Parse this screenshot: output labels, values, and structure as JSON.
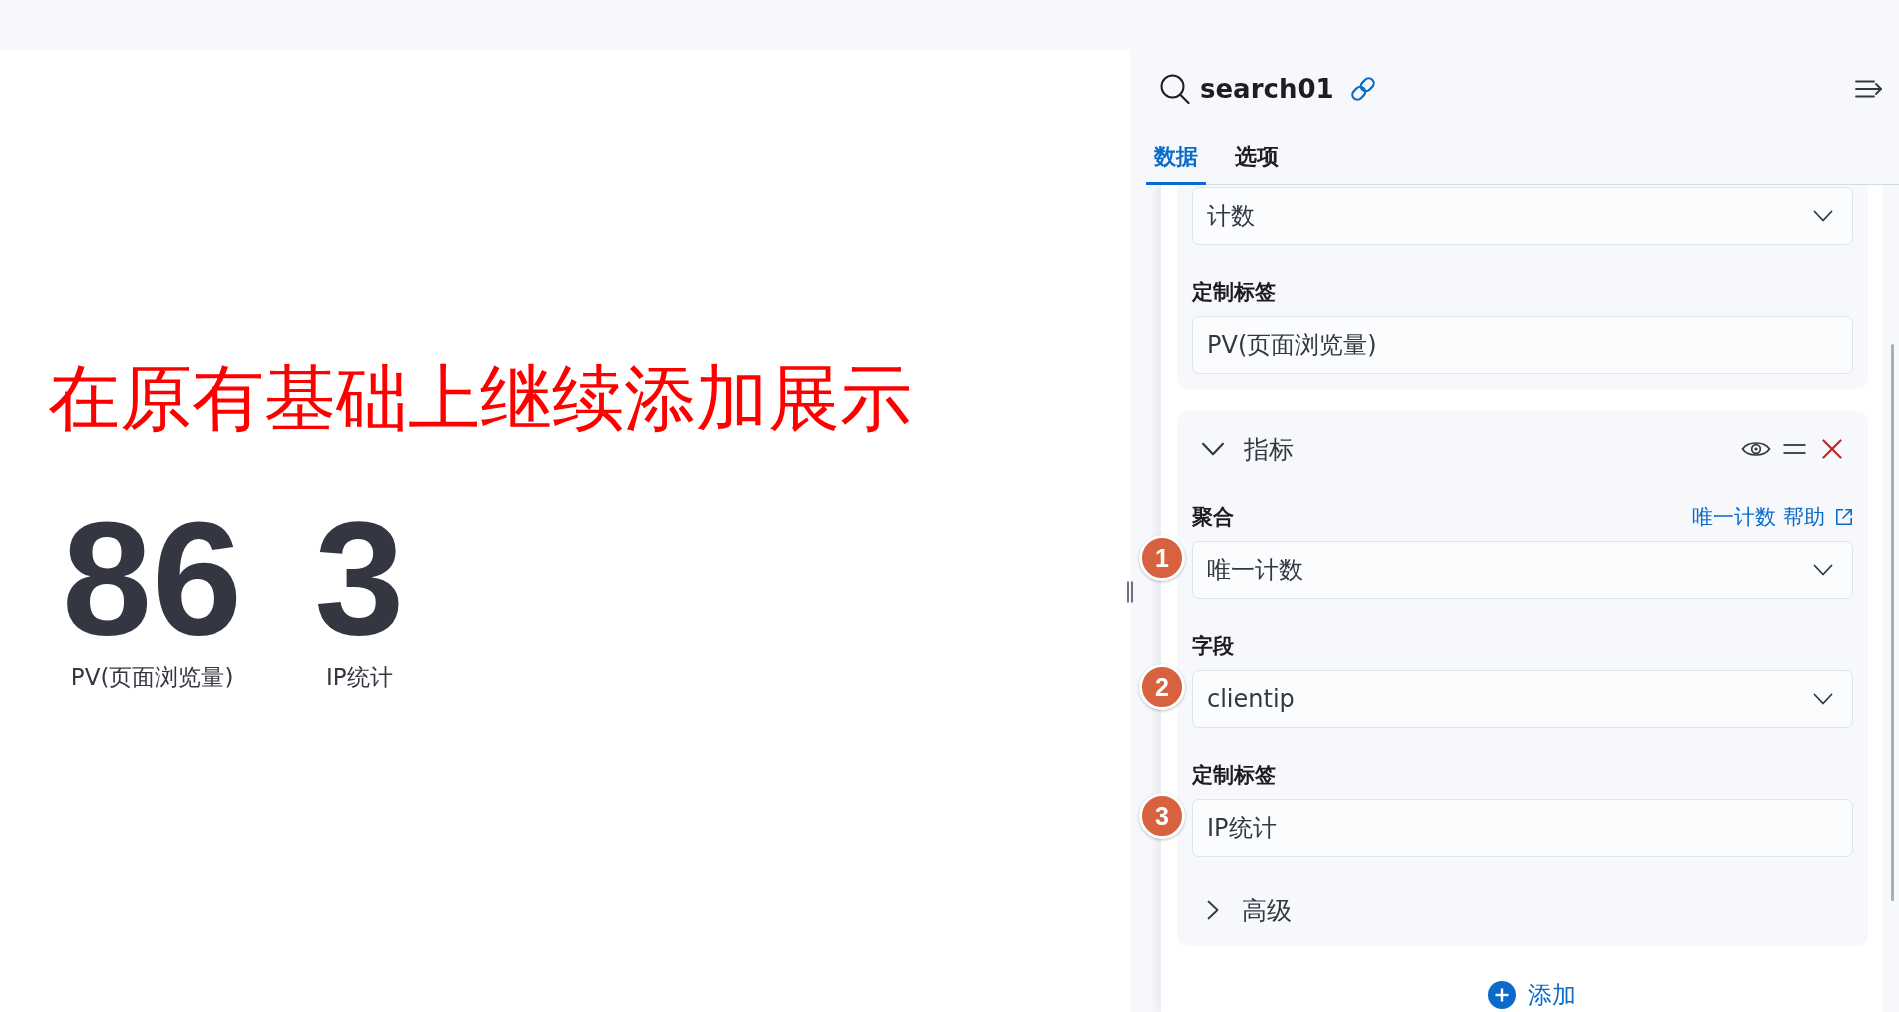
{
  "annotation": "在原有基础上继续添加展示",
  "metrics": [
    {
      "value": "86",
      "label": "PV(页面浏览量)"
    },
    {
      "value": "3",
      "label": "IP统计"
    }
  ],
  "editor": {
    "title": "search01",
    "tabs": [
      {
        "label": "数据",
        "selected": true
      },
      {
        "label": "选项",
        "selected": false
      }
    ],
    "sections": [
      {
        "fields": [
          {
            "kind": "select",
            "value": "计数"
          },
          {
            "kind": "text",
            "label": "定制标签",
            "value": "PV(页面浏览量)"
          }
        ]
      },
      {
        "title": "指标",
        "expanded": true,
        "fields": [
          {
            "kind": "select",
            "label": "聚合",
            "help_link": "唯一计数 帮助",
            "value": "唯一计数",
            "callout": "1"
          },
          {
            "kind": "select",
            "label": "字段",
            "value": "clientip",
            "callout": "2"
          },
          {
            "kind": "text",
            "label": "定制标签",
            "value": "IP统计",
            "callout": "3"
          }
        ],
        "advanced": {
          "label": "高级",
          "expanded": false
        }
      }
    ],
    "add_button": "添加"
  }
}
